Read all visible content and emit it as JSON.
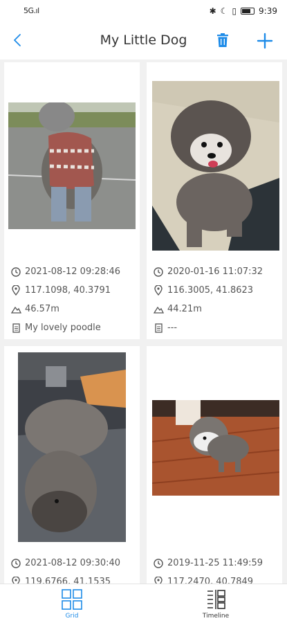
{
  "status_bar": {
    "signal": "5G.ıl",
    "icons": [
      "bluetooth-icon",
      "moon-icon",
      "vibrate-icon",
      "battery-icon"
    ],
    "time": "9:39"
  },
  "header": {
    "title": "My Little Dog",
    "accent": "#1d8be8"
  },
  "cards": [
    {
      "datetime": "2021-08-12 09:28:46",
      "coords": "117.1098, 40.3791",
      "altitude": "46.57m",
      "note": "My lovely poodle"
    },
    {
      "datetime": "2020-01-16 11:07:32",
      "coords": "116.3005, 41.8623",
      "altitude": "44.21m",
      "note": "---"
    },
    {
      "datetime": "2021-08-12 09:30:40",
      "coords": "119.6766, 41.1535"
    },
    {
      "datetime": "2019-11-25 11:49:59",
      "coords": "117.2470, 40.7849"
    }
  ],
  "nav": {
    "grid_label": "Grid",
    "timeline_label": "Timeline",
    "active": "Grid"
  }
}
